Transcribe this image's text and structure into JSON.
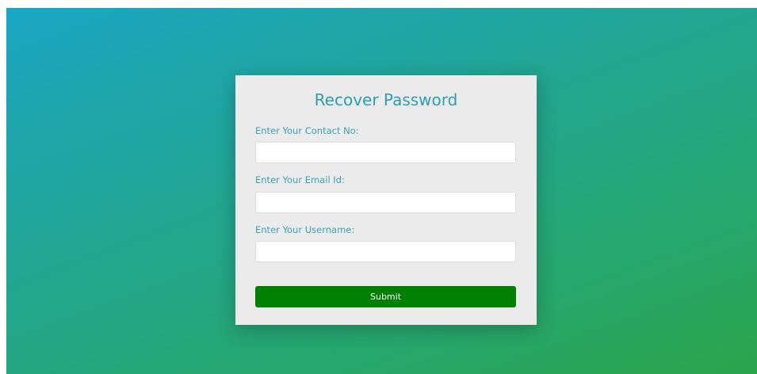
{
  "form": {
    "title": "Recover Password",
    "fields": [
      {
        "label": "Enter Your Contact No:",
        "value": "",
        "placeholder": ""
      },
      {
        "label": "Enter Your Email Id:",
        "value": "",
        "placeholder": ""
      },
      {
        "label": "Enter Your Username:",
        "value": "",
        "placeholder": ""
      }
    ],
    "submit_label": "Submit"
  },
  "colors": {
    "accent_text": "#2a9fb3",
    "submit_bg": "#008000",
    "card_bg": "#ebebeb",
    "gradient_start": "#1aa7c4",
    "gradient_end": "#2ba54c"
  }
}
